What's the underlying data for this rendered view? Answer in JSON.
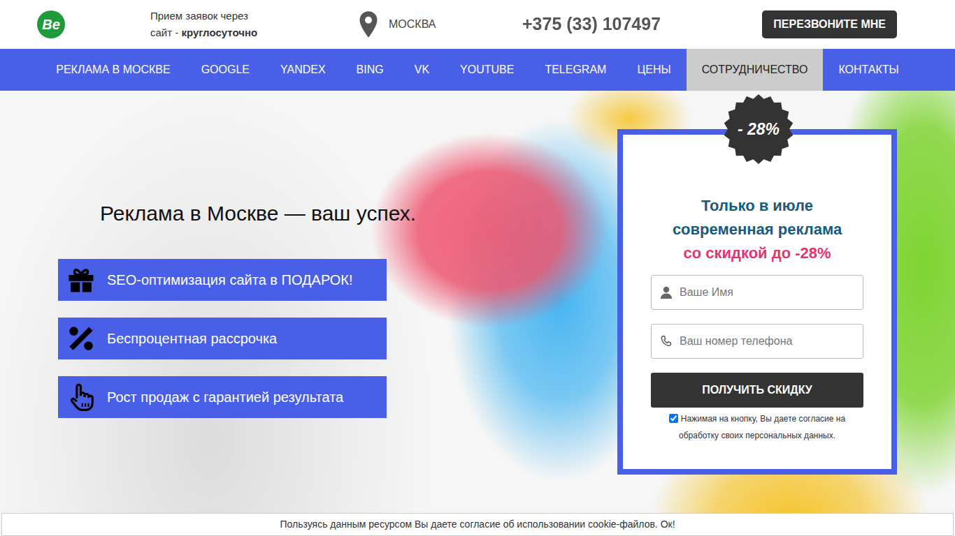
{
  "header": {
    "logo": "Be",
    "hours_line1": "Прием заявок через",
    "hours_line2": "сайт - ",
    "hours_bold": "круглосуточно",
    "city": "МОСКВА",
    "phone": "+375 (33) 107497",
    "callback_button": "ПЕРЕЗВОНИТЕ МНЕ"
  },
  "nav": [
    {
      "label": "РЕКЛАМА В МОСКВЕ",
      "selected": false
    },
    {
      "label": "GOOGLE",
      "selected": false
    },
    {
      "label": "YANDEX",
      "selected": false
    },
    {
      "label": "BING",
      "selected": false
    },
    {
      "label": "VK",
      "selected": false
    },
    {
      "label": "YOUTUBE",
      "selected": false
    },
    {
      "label": "TELEGRAM",
      "selected": false
    },
    {
      "label": "ЦЕНЫ",
      "selected": false
    },
    {
      "label": "СОТРУДНИЧЕСТВО",
      "selected": true
    },
    {
      "label": "КОНТАКТЫ",
      "selected": false
    }
  ],
  "hero": {
    "title": "Реклама в Москве — ваш успех.",
    "features": [
      "SEO-оптимизация сайта в ПОДАРОК!",
      "Беспроцентная рассрочка",
      "Рост продаж с гарантией результата"
    ]
  },
  "form": {
    "badge": "- 28%",
    "title_lines": [
      "Только в июле",
      "современная реклама"
    ],
    "highlight": "со скидкой до -28%",
    "fields": [
      {
        "placeholder": "Ваше Имя"
      },
      {
        "placeholder": "Ваш номер телефона"
      }
    ],
    "submit": "ПОЛУЧИТЬ СКИДКУ",
    "consent": {
      "text_line1": "Нажимая на кнопку, Вы даете согласие на",
      "text_line2": "обработку своих персональных данных.",
      "checked": true
    }
  },
  "cookie_bar": {
    "text": "Пользуясь данным ресурсом Вы даете согласие об использовании cookie-файлов. Ок!"
  }
}
